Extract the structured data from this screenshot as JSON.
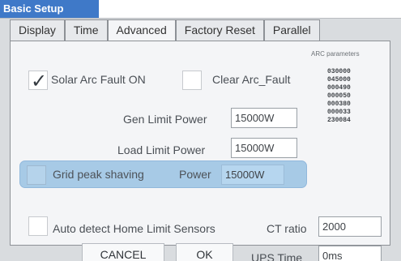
{
  "window": {
    "title": "Basic Setup"
  },
  "tabs": [
    {
      "label": "Display"
    },
    {
      "label": "Time"
    },
    {
      "label": "Advanced"
    },
    {
      "label": "Factory Reset"
    },
    {
      "label": "Parallel"
    }
  ],
  "fields": {
    "solar_arc_fault_label": "Solar Arc Fault ON",
    "clear_arc_fault_label": "Clear Arc_Fault",
    "gen_limit_power_label": "Gen Limit Power",
    "gen_limit_power_value": "15000W",
    "load_limit_power_label": "Load Limit Power",
    "load_limit_power_value": "15000W",
    "grid_peak_shaving_label": "Grid peak shaving",
    "power_label": "Power",
    "power_value": "15000W",
    "auto_detect_label": "Auto detect Home Limit Sensors",
    "ct_ratio_label": "CT ratio",
    "ct_ratio_value": "2000",
    "ups_time_label": "UPS Time",
    "ups_time_value": "0ms"
  },
  "arc": {
    "title": "ARC parameters",
    "values": [
      "030000",
      "045000",
      "000490",
      "000050",
      "000380",
      "000033",
      "230084"
    ]
  },
  "buttons": {
    "cancel": "CANCEL",
    "ok": "OK"
  },
  "state": {
    "solar_arc_fault_checked": true,
    "clear_arc_fault_checked": false,
    "grid_peak_shaving_checked": false,
    "auto_detect_checked": false,
    "active_tab": "Advanced"
  },
  "colors": {
    "title_bar": "#3f79c8",
    "highlight": "#a7cae6"
  }
}
